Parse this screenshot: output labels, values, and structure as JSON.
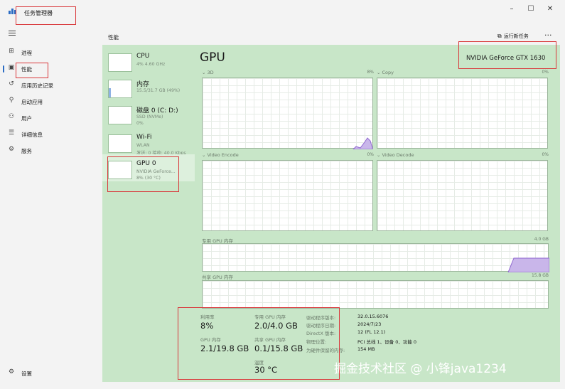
{
  "window": {
    "title": "任务管理器",
    "controls": {
      "minimize": "–",
      "maximize": "☐",
      "close": "✕"
    }
  },
  "sidebar": {
    "items": [
      {
        "label": "进程",
        "icon": "processes-icon"
      },
      {
        "label": "性能",
        "icon": "performance-icon"
      },
      {
        "label": "应用历史记录",
        "icon": "history-icon"
      },
      {
        "label": "启动应用",
        "icon": "startup-icon"
      },
      {
        "label": "用户",
        "icon": "users-icon"
      },
      {
        "label": "详细信息",
        "icon": "details-icon"
      },
      {
        "label": "服务",
        "icon": "services-icon"
      }
    ],
    "settings_label": "设置"
  },
  "header": {
    "title": "性能",
    "run_task_label": "运行新任务",
    "more_label": "···"
  },
  "resources": [
    {
      "name": "CPU",
      "sub1": "4% 4.60 GHz",
      "sub2": ""
    },
    {
      "name": "内存",
      "sub1": "15.5/31.7 GB (49%)",
      "sub2": ""
    },
    {
      "name": "磁盘 0 (C: D:)",
      "sub1": "SSD (NVMe)",
      "sub2": "0%"
    },
    {
      "name": "Wi-Fi",
      "sub1": "WLAN",
      "sub2": "发送: 0 接收: 40.0 Kbps"
    },
    {
      "name": "GPU 0",
      "sub1": "NVIDIA GeForce...",
      "sub2": "8% (30 °C)"
    }
  ],
  "gpu": {
    "title": "GPU",
    "model": "NVIDIA GeForce GTX 1630",
    "engines": [
      {
        "label": "3D",
        "pct": "8%"
      },
      {
        "label": "Copy",
        "pct": "0%"
      },
      {
        "label": "Video Encode",
        "pct": "0%"
      },
      {
        "label": "Video Decode",
        "pct": "0%"
      }
    ],
    "dedicated_memory": {
      "label": "专用 GPU 内存",
      "max": "4.0 GB"
    },
    "shared_memory": {
      "label": "共享 GPU 内存",
      "max": "15.8 GB"
    },
    "stats": {
      "utilization": {
        "label": "利用率",
        "value": "8%"
      },
      "dedicated": {
        "label": "专用 GPU 内存",
        "value": "2.0/4.0 GB"
      },
      "gpu_memory": {
        "label": "GPU 内存",
        "value": "2.1/19.8 GB"
      },
      "shared": {
        "label": "共享 GPU 内存",
        "value": "0.1/15.8 GB"
      },
      "temperature": {
        "label": "温度",
        "value": "30 °C"
      }
    },
    "details": [
      {
        "label": "驱动程序版本:",
        "value": "32.0.15.6076"
      },
      {
        "label": "驱动程序日期:",
        "value": "2024/7/23"
      },
      {
        "label": "DirectX 版本:",
        "value": "12 (FL 12.1)"
      },
      {
        "label": "物理位置:",
        "value": "PCI 总线 1、设备 0、功能 0"
      },
      {
        "label": "为硬件保留的内存:",
        "value": "154 MB"
      }
    ]
  },
  "watermark": "掘金技术社区 @ 小锋java1234",
  "colors": {
    "accent": "#2b6cc4",
    "panel": "#c8e6c8",
    "annotation": "#d9383b",
    "graph_fill": "#c9b6ea"
  }
}
